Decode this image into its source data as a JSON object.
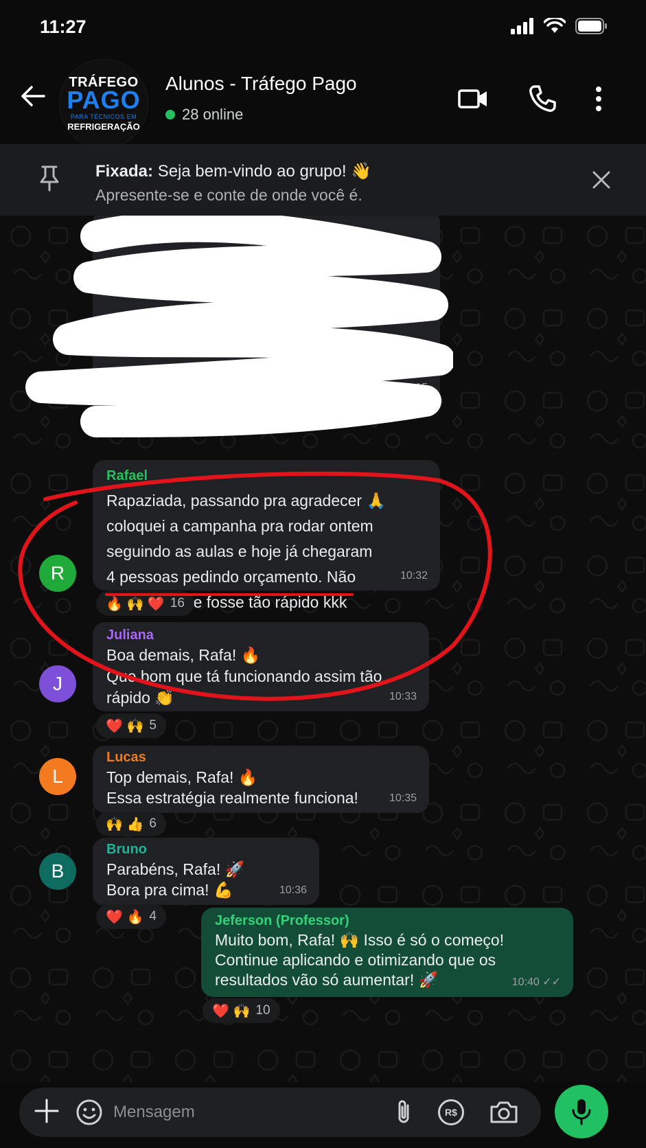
{
  "status_bar": {
    "time": "11:27"
  },
  "header": {
    "avatar_lines": [
      "TRÁFEGO",
      "PAGO",
      "PARA TÉCNICOS EM",
      "REFRIGERAÇÃO"
    ],
    "title": "Alunos - Tráfego Pago",
    "status": "28 online"
  },
  "pinned": {
    "label": "Fixada:",
    "text": "Seja bem-vindo ao grupo! 👋",
    "subtext": "Apresente-se e conte de onde você é."
  },
  "messages": [
    {
      "sender": "",
      "text": "",
      "time": "10:15",
      "redacted": true
    },
    {
      "sender": "Rafael",
      "sender_color": "#25c15f",
      "avatar": "R",
      "avatar_color": "#1faa3a",
      "text": "Rapaziada, passando pra agradecer 🙏\ncoloquei a campanha pra rodar ontem\nseguindo as aulas e hoje já chegaram\n4 pessoas pedindo orçamento. Não\nesperava que fosse tão rápido kkk",
      "time": "10:32",
      "reactions": "🔥 🙌 ❤️",
      "reaction_count": "16"
    },
    {
      "sender": "Juliana",
      "sender_color": "#a86af0",
      "avatar": "J",
      "avatar_color": "#7e4fd8",
      "text": "Boa demais, Rafa! 🔥\nQue bom que tá funcionando assim tão\nrápido 👏",
      "time": "10:33",
      "reactions": "❤️ 🙌",
      "reaction_count": "5"
    },
    {
      "sender": "Lucas",
      "sender_color": "#f07a1c",
      "avatar": "L",
      "avatar_color": "#f47a1f",
      "text": "Top demais, Rafa! 🔥\nEssa estratégia realmente funciona!",
      "time": "10:35",
      "reactions": "🙌 👍",
      "reaction_count": "6"
    },
    {
      "sender": "Bruno",
      "sender_color": "#1fb39a",
      "avatar": "B",
      "avatar_color": "#0e6b60",
      "text": "Parabéns, Rafa! 🚀\nBora pra cima! 💪",
      "time": "10:36",
      "reactions": "❤️ 🔥",
      "reaction_count": "4"
    },
    {
      "sender": "Jeferson (Professor)",
      "sender_color": "#33d17a",
      "text": "Muito bom, Rafa! 🙌 Isso é só o começo!\nContinue aplicando e otimizando que os\nresultados vão só aumentar! 🚀",
      "time": "10:40 ✓✓",
      "reactions": "❤️ 🙌",
      "reaction_count": "10"
    }
  ],
  "input": {
    "placeholder": "Mensagem",
    "currency_label": "R$"
  },
  "colors": {
    "accent": "#21c063",
    "annotation": "#e0141a"
  }
}
